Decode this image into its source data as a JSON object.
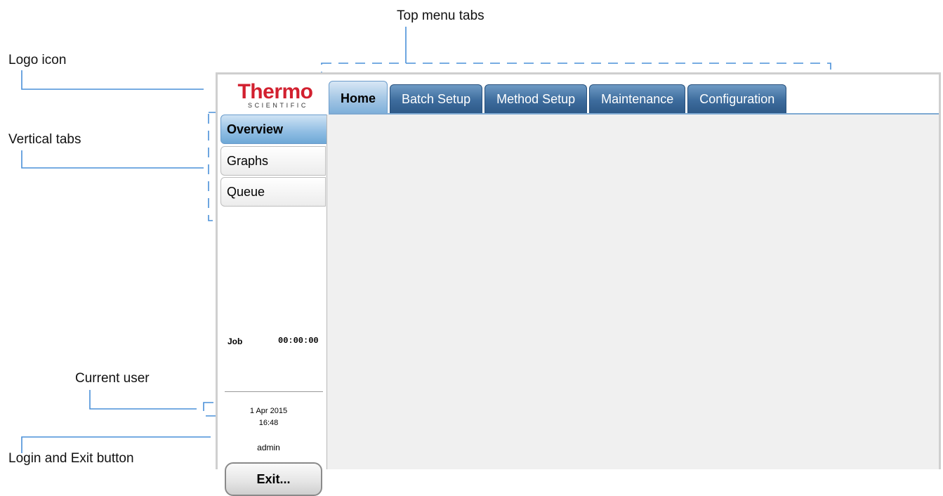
{
  "annotations": {
    "top_menu_tabs": "Top menu tabs",
    "logo_icon": "Logo icon",
    "vertical_tabs": "Vertical tabs",
    "current_user": "Current user",
    "login_exit": "Login and Exit button"
  },
  "logo": {
    "main": "Thermo",
    "sub": "SCIENTIFIC"
  },
  "top_tabs": [
    {
      "label": "Home",
      "active": true
    },
    {
      "label": "Batch Setup",
      "active": false
    },
    {
      "label": "Method Setup",
      "active": false
    },
    {
      "label": "Maintenance",
      "active": false
    },
    {
      "label": "Configuration",
      "active": false
    }
  ],
  "side_tabs": [
    {
      "label": "Overview",
      "active": true
    },
    {
      "label": "Graphs",
      "active": false
    },
    {
      "label": "Queue",
      "active": false
    }
  ],
  "status": {
    "job_label": "Job",
    "job_time": "00:00:00",
    "date": "1 Apr 2015",
    "time": "16:48",
    "user": "admin"
  },
  "exit_button": "Exit...",
  "colors": {
    "brand_red": "#d2202f",
    "tab_blue": "#3d6c9d",
    "active_tab_blue": "#9fc3e3",
    "annotation_line": "#4a90d9"
  }
}
